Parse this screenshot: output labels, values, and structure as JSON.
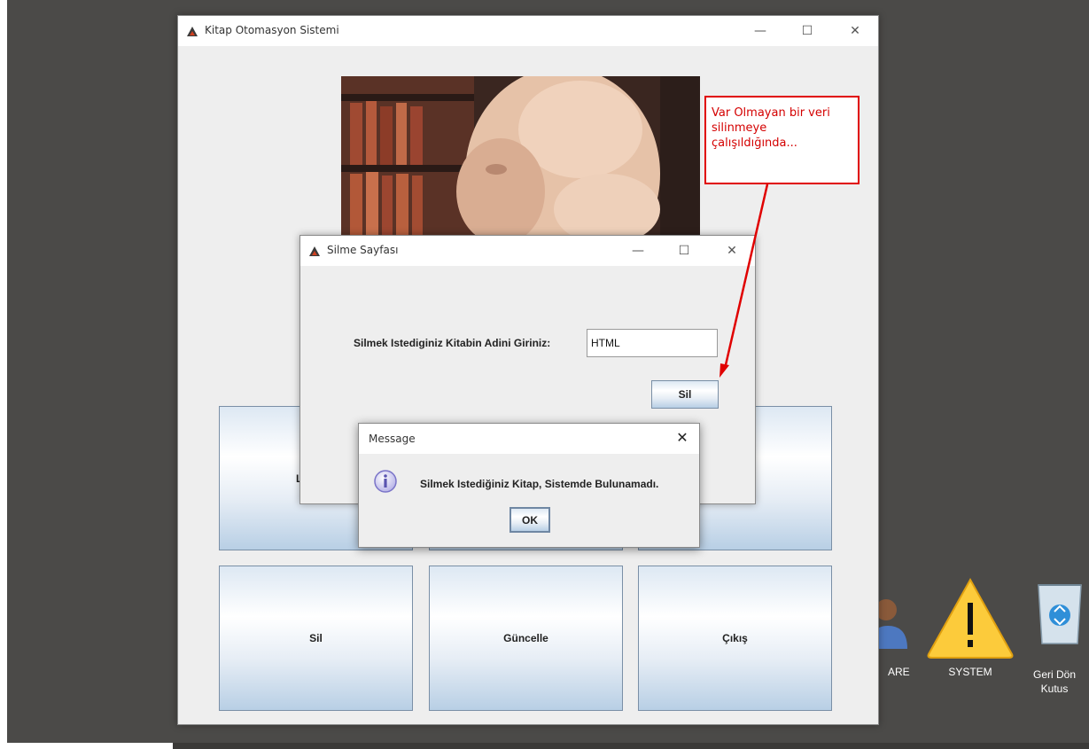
{
  "main_window": {
    "title": "Kitap Otomasyon Sistemi",
    "buttons": {
      "sil": "Sil",
      "guncelle": "Güncelle",
      "cikis": "Çıkış",
      "partial_left": "L"
    }
  },
  "delete_window": {
    "title": "Silme Sayfası",
    "prompt": "Silmek Istediginiz Kitabin Adini Giriniz:",
    "input_value": "HTML",
    "sil_button": "Sil"
  },
  "message_dialog": {
    "title": "Message",
    "text": "Silmek Istediğiniz Kitap, Sistemde Bulunamadı.",
    "ok_button": "OK"
  },
  "annotation": {
    "text": "Var Olmayan bir veri silinmeye çalışıldığında..."
  },
  "desktop": {
    "icons": [
      {
        "name": "user-icon",
        "label": "ARE"
      },
      {
        "name": "warning-icon",
        "label": "SYSTEM"
      },
      {
        "name": "recycle-bin-icon",
        "label": "Geri Dön Kutus"
      }
    ]
  },
  "colors": {
    "annotation": "#e00000",
    "desktop": "#4b4a48",
    "window_bg": "#eeeeee"
  }
}
